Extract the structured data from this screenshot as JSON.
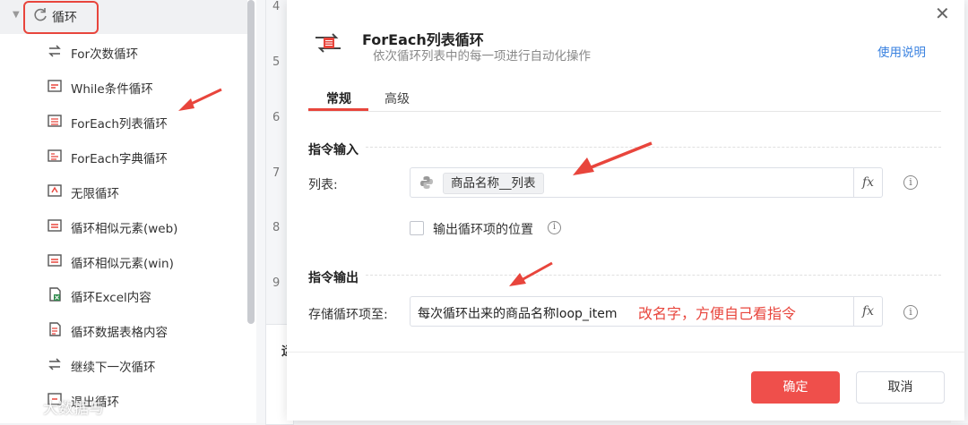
{
  "sidebar": {
    "group_label": "循环",
    "items": [
      {
        "label": "For次数循环",
        "icon": "for-loop-icon"
      },
      {
        "label": "While条件循环",
        "icon": "while-loop-icon"
      },
      {
        "label": "ForEach列表循环",
        "icon": "foreach-list-icon"
      },
      {
        "label": "ForEach字典循环",
        "icon": "foreach-dict-icon"
      },
      {
        "label": "无限循环",
        "icon": "infinite-loop-icon"
      },
      {
        "label": "循环相似元素(web)",
        "icon": "loop-web-icon"
      },
      {
        "label": "循环相似元素(win)",
        "icon": "loop-win-icon"
      },
      {
        "label": "循环Excel内容",
        "icon": "excel-icon"
      },
      {
        "label": "循环数据表格内容",
        "icon": "table-icon"
      },
      {
        "label": "继续下一次循环",
        "icon": "continue-icon"
      },
      {
        "label": "退出循环",
        "icon": "break-icon"
      }
    ]
  },
  "editor": {
    "line_numbers": [
      "4",
      "5",
      "6",
      "7",
      "8",
      "9"
    ],
    "bottom_card_text": "运"
  },
  "dialog": {
    "title": "ForEach列表循环",
    "subtitle": "依次循环列表中的每一项进行自动化操作",
    "help_link": "使用说明",
    "tabs": [
      "常规",
      "高级"
    ],
    "input_section": "指令输入",
    "list_label": "列表:",
    "list_value": "商品名称__列表",
    "checkbox_label": "输出循环项的位置",
    "checkbox_checked": false,
    "output_section": "指令输出",
    "store_label": "存储循环项至:",
    "store_value": "每次循环出来的商品名称loop_item",
    "fx_label": "fx",
    "ok_button": "确定",
    "cancel_button": "取消"
  },
  "annotation": {
    "text": "改名字，方便自己看指令",
    "color": "#e8453c"
  },
  "watermark": "大数据与",
  "colors": {
    "accent": "#e8453c",
    "primary_button": "#ef4f4b",
    "link": "#3a82e0"
  }
}
